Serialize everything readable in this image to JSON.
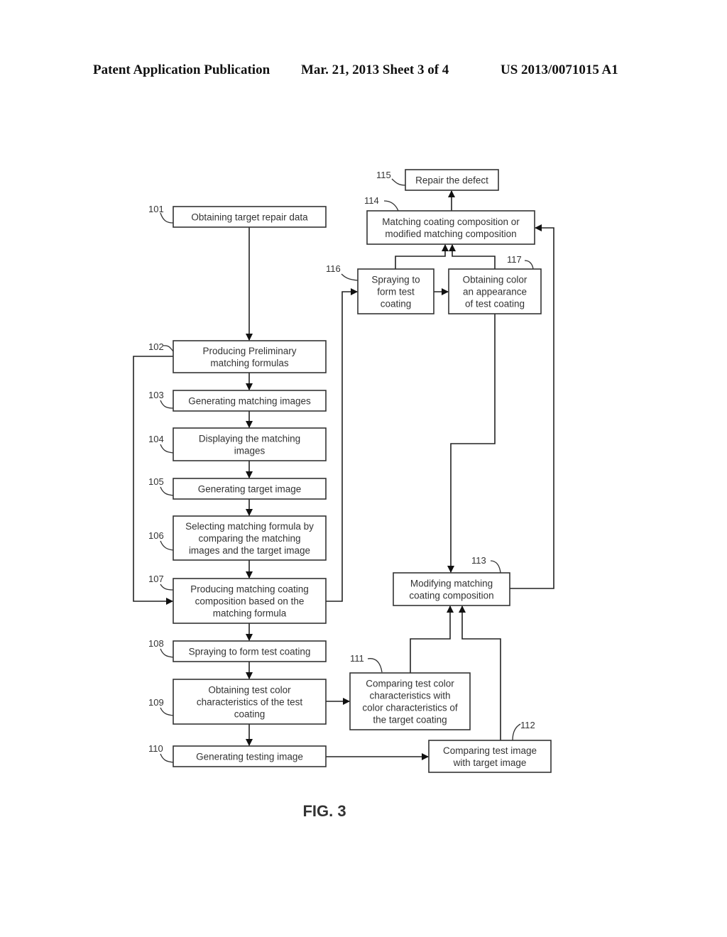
{
  "header": {
    "publication": "Patent Application Publication",
    "date_sheet": "Mar. 21, 2013  Sheet 3 of 4",
    "number": "US 2013/0071015 A1"
  },
  "figure_label": "FIG. 3",
  "steps": [
    {
      "ref": "101",
      "lines": [
        "Obtaining target repair data"
      ]
    },
    {
      "ref": "102",
      "lines": [
        "Producing Preliminary",
        "matching formulas"
      ]
    },
    {
      "ref": "103",
      "lines": [
        "Generating matching images"
      ]
    },
    {
      "ref": "104",
      "lines": [
        "Displaying the matching",
        "images"
      ]
    },
    {
      "ref": "105",
      "lines": [
        "Generating target image"
      ]
    },
    {
      "ref": "106",
      "lines": [
        "Selecting matching formula by",
        "comparing the matching",
        "images and the target image"
      ]
    },
    {
      "ref": "107",
      "lines": [
        "Producing matching coating",
        "composition based on the",
        "matching formula"
      ]
    },
    {
      "ref": "108",
      "lines": [
        "Spraying to form test coating"
      ]
    },
    {
      "ref": "109",
      "lines": [
        "Obtaining test color",
        "characteristics of the test",
        "coating"
      ]
    },
    {
      "ref": "110",
      "lines": [
        "Generating testing image"
      ]
    },
    {
      "ref": "111",
      "lines": [
        "Comparing test color",
        "characteristics with",
        "color characteristics of",
        "the target coating"
      ]
    },
    {
      "ref": "112",
      "lines": [
        "Comparing test image",
        "with target image"
      ]
    },
    {
      "ref": "113",
      "lines": [
        "Modifying matching",
        "coating composition"
      ]
    },
    {
      "ref": "114",
      "lines": [
        "Matching coating composition or",
        "modified matching composition"
      ]
    },
    {
      "ref": "115",
      "lines": [
        "Repair the defect"
      ]
    },
    {
      "ref": "116",
      "lines": [
        "Spraying to",
        "form test",
        "coating"
      ]
    },
    {
      "ref": "117",
      "lines": [
        "Obtaining color",
        "an appearance",
        "of test coating"
      ]
    }
  ],
  "connections": [
    {
      "from": "101",
      "to": "102"
    },
    {
      "from": "102",
      "to": "103"
    },
    {
      "from": "102",
      "to": "107"
    },
    {
      "from": "103",
      "to": "104"
    },
    {
      "from": "104",
      "to": "105"
    },
    {
      "from": "105",
      "to": "106"
    },
    {
      "from": "106",
      "to": "107"
    },
    {
      "from": "107",
      "to": "108"
    },
    {
      "from": "107",
      "to": "116"
    },
    {
      "from": "108",
      "to": "109"
    },
    {
      "from": "109",
      "to": "110"
    },
    {
      "from": "109",
      "to": "111"
    },
    {
      "from": "110",
      "to": "112"
    },
    {
      "from": "111",
      "to": "113"
    },
    {
      "from": "112",
      "to": "113"
    },
    {
      "from": "113",
      "to": "114"
    },
    {
      "from": "116",
      "to": "117"
    },
    {
      "from": "116",
      "to": "114"
    },
    {
      "from": "117",
      "to": "114"
    },
    {
      "from": "117",
      "to": "113"
    },
    {
      "from": "114",
      "to": "115"
    }
  ]
}
